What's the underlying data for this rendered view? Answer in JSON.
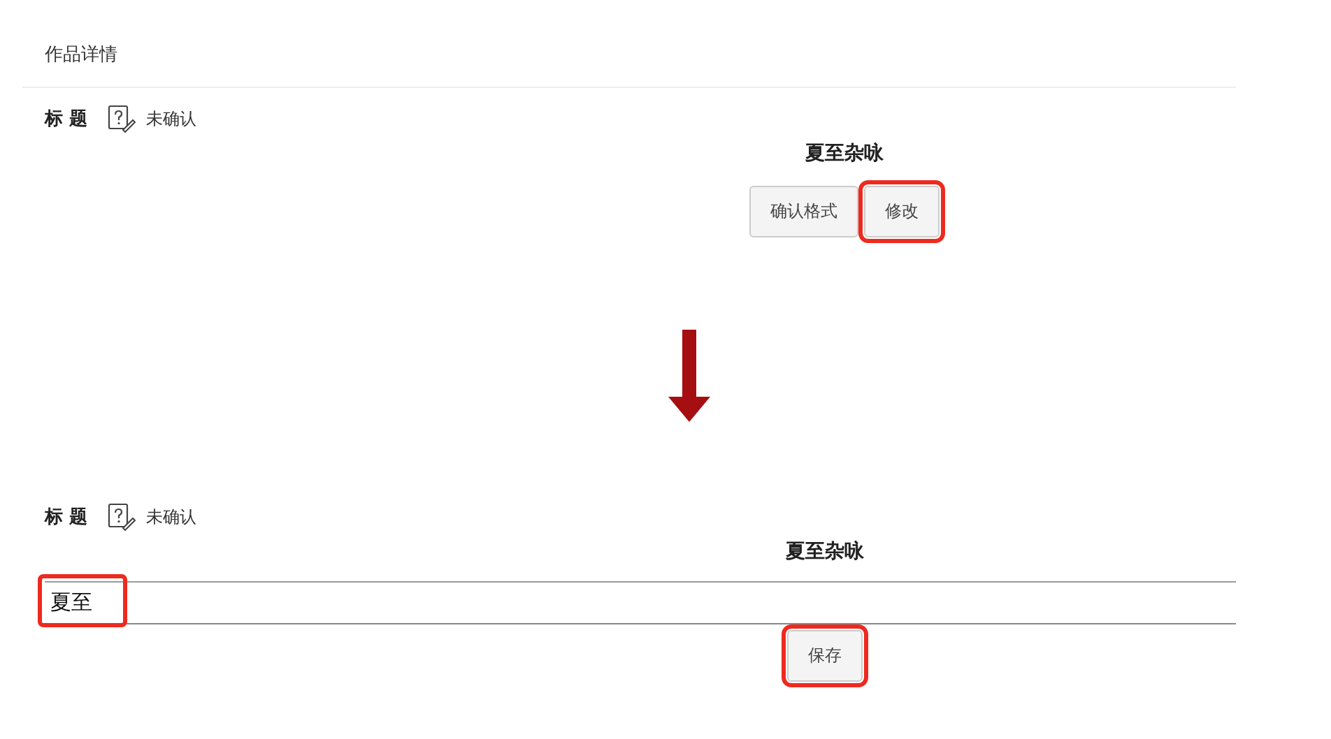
{
  "header": {
    "title": "作品详情"
  },
  "panels": [
    {
      "field_label": "标 题",
      "status": "未确认",
      "title": "夏至杂咏",
      "kind": "view",
      "buttons": [
        {
          "label": "确认格式",
          "highlighted": false
        },
        {
          "label": "修改",
          "highlighted": true
        }
      ]
    },
    {
      "field_label": "标 题",
      "status": "未确认",
      "title": "夏至杂咏",
      "kind": "edit",
      "input": {
        "value": "夏至",
        "highlighted": true
      },
      "buttons": [
        {
          "label": "保存",
          "highlighted": true
        }
      ]
    }
  ]
}
